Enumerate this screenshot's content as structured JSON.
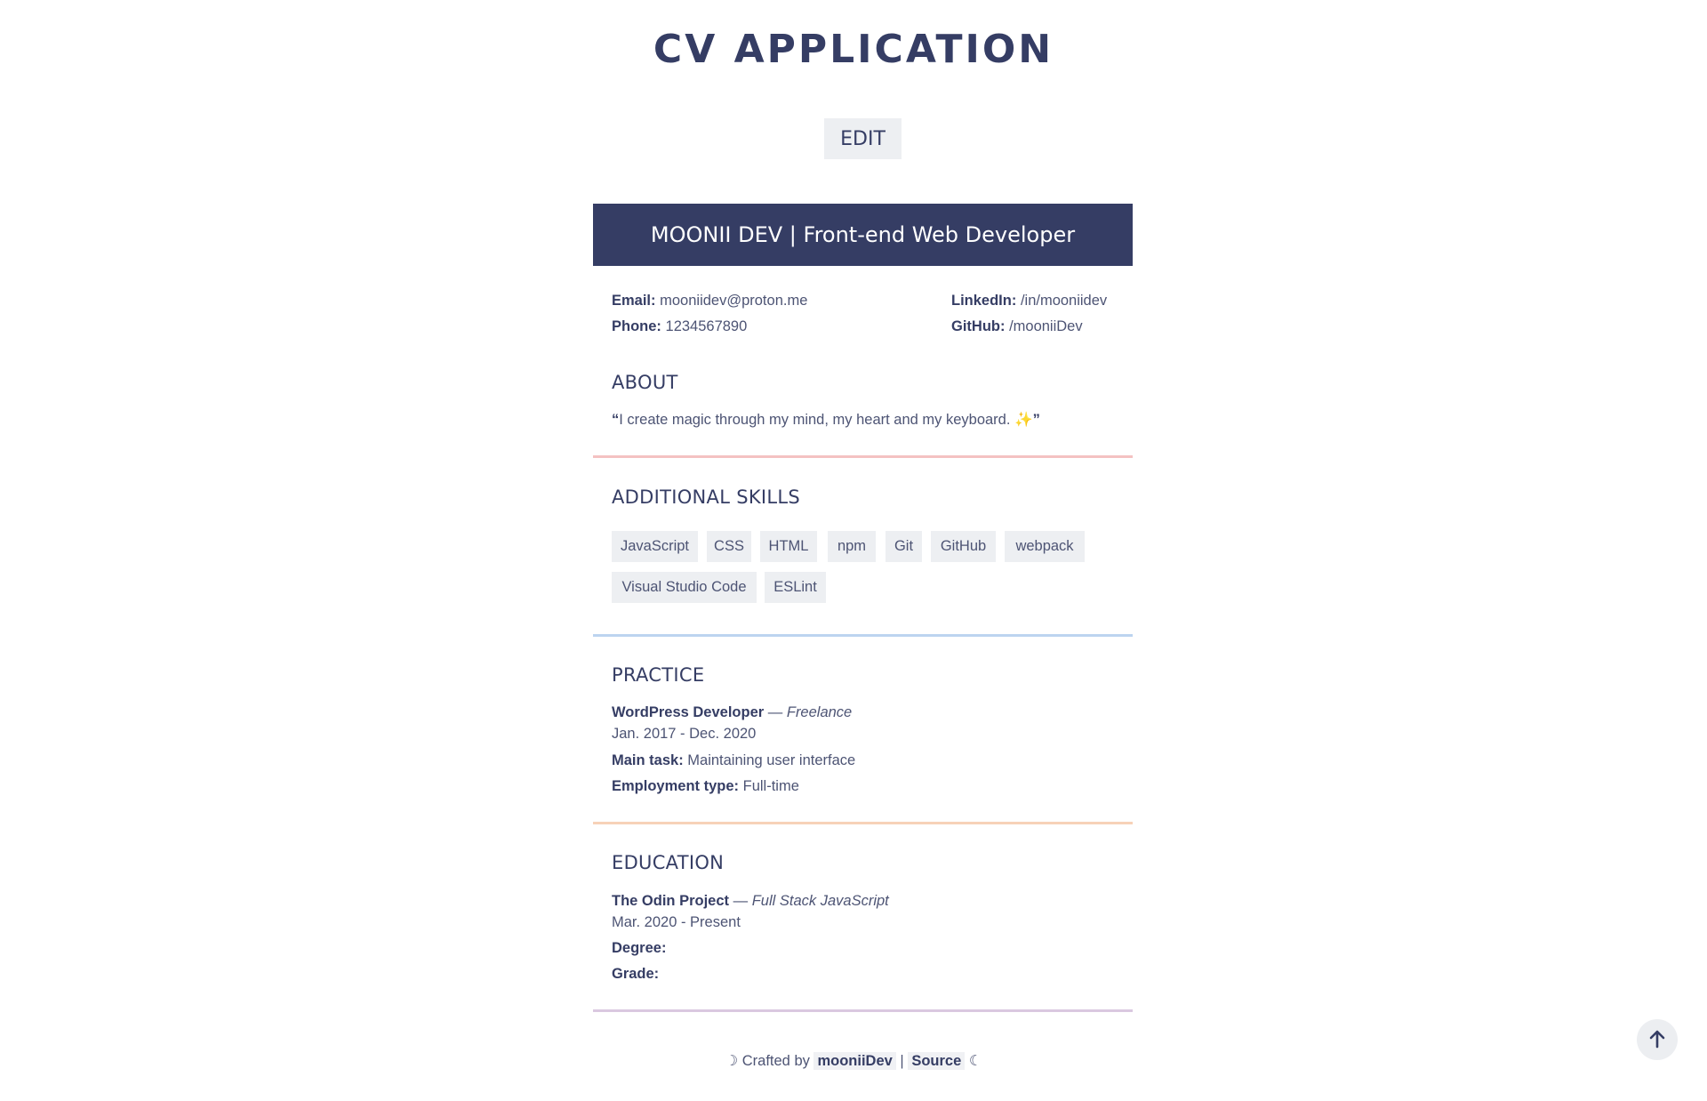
{
  "title": "CV APPLICATION",
  "edit_label": "EDIT",
  "header": "MOONII DEV | Front-end Web Developer",
  "contacts": {
    "email_label": "Email:",
    "email": "mooniidev@proton.me",
    "phone_label": "Phone:",
    "phone": "1234567890",
    "linkedin_label": "LinkedIn:",
    "linkedin": "/in/mooniidev",
    "github_label": "GitHub:",
    "github": "/mooniiDev"
  },
  "about": {
    "heading": "ABOUT",
    "quote_open": "“",
    "text": "I create magic through my mind, my heart and my keyboard. ",
    "emoji": "✨",
    "quote_close": "”"
  },
  "skills": {
    "heading": "ADDITIONAL SKILLS",
    "items": [
      "JavaScript",
      "CSS",
      "HTML",
      "npm",
      "Git",
      "GitHub",
      "webpack",
      "Visual Studio Code",
      "ESLint"
    ]
  },
  "practice": {
    "heading": "PRACTICE",
    "role": "WordPress Developer",
    "sep": " — ",
    "company": "Freelance",
    "dates": "Jan. 2017 - Dec. 2020",
    "task_label": "Main task:",
    "task": "Maintaining user interface",
    "type_label": "Employment type:",
    "type": "Full-time"
  },
  "education": {
    "heading": "EDUCATION",
    "school": "The Odin Project",
    "sep": " — ",
    "program": "Full Stack JavaScript",
    "dates": "Mar. 2020 - Present",
    "degree_label": "Degree:",
    "grade_label": "Grade:"
  },
  "footer": {
    "moon_left": "☽",
    "crafted": "Crafted by",
    "author": "mooniiDev",
    "pipe": "|",
    "source": "Source",
    "moon_right": "☾"
  },
  "colors": {
    "primary": "#353d64",
    "title_highlight": "#bcdcdb",
    "about_divider": "#f4c2c2",
    "skills_divider": "#bcd4f0",
    "practice_divider": "#f7d2b8",
    "education_divider": "#dac8e0"
  },
  "icons": {
    "scroll_top": "arrow-up-icon"
  }
}
